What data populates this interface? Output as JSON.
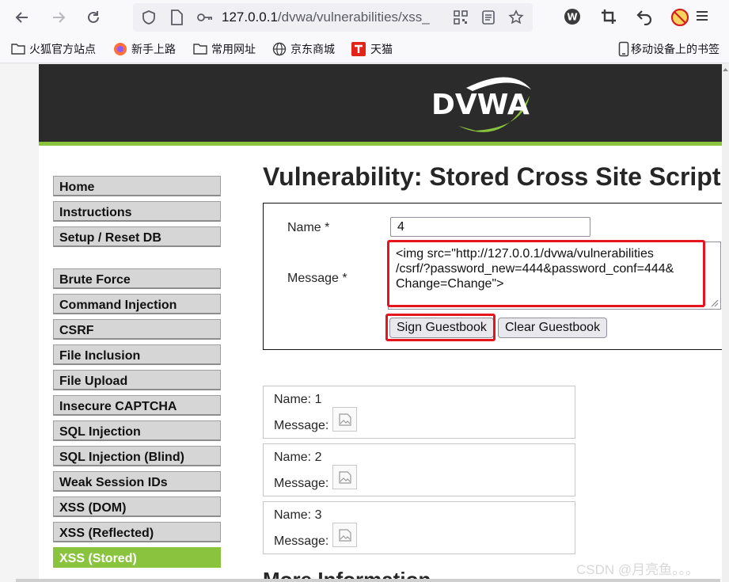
{
  "browser": {
    "url_main": "127.0.0.1",
    "url_rest": "/dvwa/vulnerabilities/xss_",
    "bookmarks": [
      "火狐官方站点",
      "新手上路",
      "常用网址",
      "京东商城",
      "天猫"
    ],
    "mobile_bookmarks": "移动设备上的书签"
  },
  "site": {
    "logo_text": "DVWA",
    "menu_group1": [
      "Home",
      "Instructions",
      "Setup / Reset DB"
    ],
    "menu_group2": [
      "Brute Force",
      "Command Injection",
      "CSRF",
      "File Inclusion",
      "File Upload",
      "Insecure CAPTCHA",
      "SQL Injection",
      "SQL Injection (Blind)",
      "Weak Session IDs",
      "XSS (DOM)",
      "XSS (Reflected)",
      "XSS (Stored)"
    ],
    "active_item": "XSS (Stored)"
  },
  "main": {
    "title": "Vulnerability: Stored Cross Site Scripting (XSS)",
    "form": {
      "name_label": "Name *",
      "name_value": "4",
      "message_label": "Message *",
      "message_value": "<img src=\"http://127.0.0.1/dvwa/vulnerabilities/csrf/?password_new=444&password_conf=444&Change=Change\">",
      "message_line1": "<img src=\"http://127.0.0.1/dvwa/vulnerabilities",
      "message_line2": "/csrf/?password_new=444&password_conf=444&",
      "message_line3": "Change=Change\">",
      "sign_button": "Sign Guestbook",
      "clear_button": "Clear Guestbook"
    },
    "entries": [
      {
        "name": "Name: 1",
        "message": "Message:"
      },
      {
        "name": "Name: 2",
        "message": "Message:"
      },
      {
        "name": "Name: 3",
        "message": "Message:"
      }
    ],
    "more_info": "More Information"
  },
  "watermark": "CSDN @月亮鱼。。。",
  "colors": {
    "accent": "#8ac43f",
    "header_bg": "#2b2b2b",
    "highlight": "#e6141e"
  }
}
